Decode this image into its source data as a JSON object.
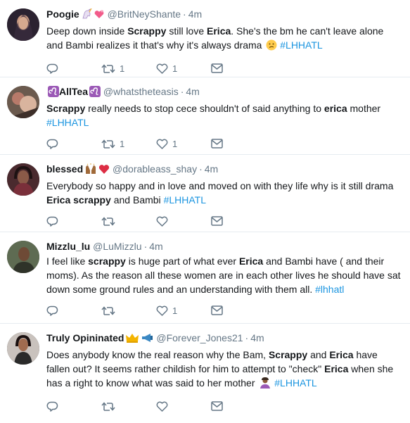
{
  "colors": {
    "link": "#1b95e0",
    "muted": "#657786",
    "divider": "#e6ecf0"
  },
  "tweets": [
    {
      "name": "Poogie",
      "name_emoji": [
        "unicorn-icon",
        "two-hearts-icon"
      ],
      "handle": "@BritNeyShante",
      "dot": "·",
      "time": "4m",
      "text": [
        "Deep down inside ",
        "Scrappy",
        " still love ",
        "Erica",
        ". She's the bm he can't leave alone and Bambi realizes it that's why it's always drama ",
        "#LHHATL"
      ],
      "inline_emoji": "confused-face-icon",
      "counts": {
        "reply": "",
        "retweet": "1",
        "like": "1"
      }
    },
    {
      "name": "AllTea",
      "name_emoji": [
        "leo-icon",
        "leo-icon"
      ],
      "handle": "@whatstheteasis",
      "dot": "·",
      "time": "4m",
      "text": [
        "Scrappy",
        " really needs to stop cece shouldn't of said anything to ",
        "erica",
        " mother ",
        "#LHHATL"
      ],
      "counts": {
        "reply": "",
        "retweet": "1",
        "like": "1"
      }
    },
    {
      "name": "blessed",
      "name_emoji": [
        "raising-hands-icon",
        "red-heart-icon"
      ],
      "handle": "@dorableass_shay",
      "dot": "·",
      "time": "4m",
      "text": [
        "Everybody so happy and in love and moved on with they life why is it still drama ",
        "Erica",
        " ",
        "scrappy",
        " and Bambi ",
        "#LHHATL"
      ],
      "counts": {
        "reply": "",
        "retweet": "",
        "like": ""
      }
    },
    {
      "name": "Mizzlu_lu",
      "name_emoji": [],
      "handle": "@LuMizzlu",
      "dot": "·",
      "time": "4m",
      "text": [
        "I feel like ",
        "scrappy",
        " is huge part of what ever ",
        "Erica",
        " and Bambi have ( and their moms). As the reason all these women are in each other lives he should have sat down some ground rules and an understanding with them all. ",
        "#lhhatl"
      ],
      "counts": {
        "reply": "",
        "retweet": "",
        "like": "1"
      }
    },
    {
      "name": "Truly Opininated",
      "name_emoji": [
        "crown-icon",
        "megaphone-icon"
      ],
      "handle": "@Forever_Jones21",
      "dot": "·",
      "time": "4m",
      "text": [
        "Does anybody know the real reason why the Bam, ",
        "Scrappy",
        " and ",
        "Erica",
        " have fallen out? It seems rather childish for him to attempt to \"check\" ",
        "Erica",
        " when she has a right to know what was said to her mother ",
        "#LHHATL"
      ],
      "inline_emoji": "person-gesturing-icon",
      "counts": {
        "reply": "",
        "retweet": "",
        "like": ""
      }
    }
  ]
}
